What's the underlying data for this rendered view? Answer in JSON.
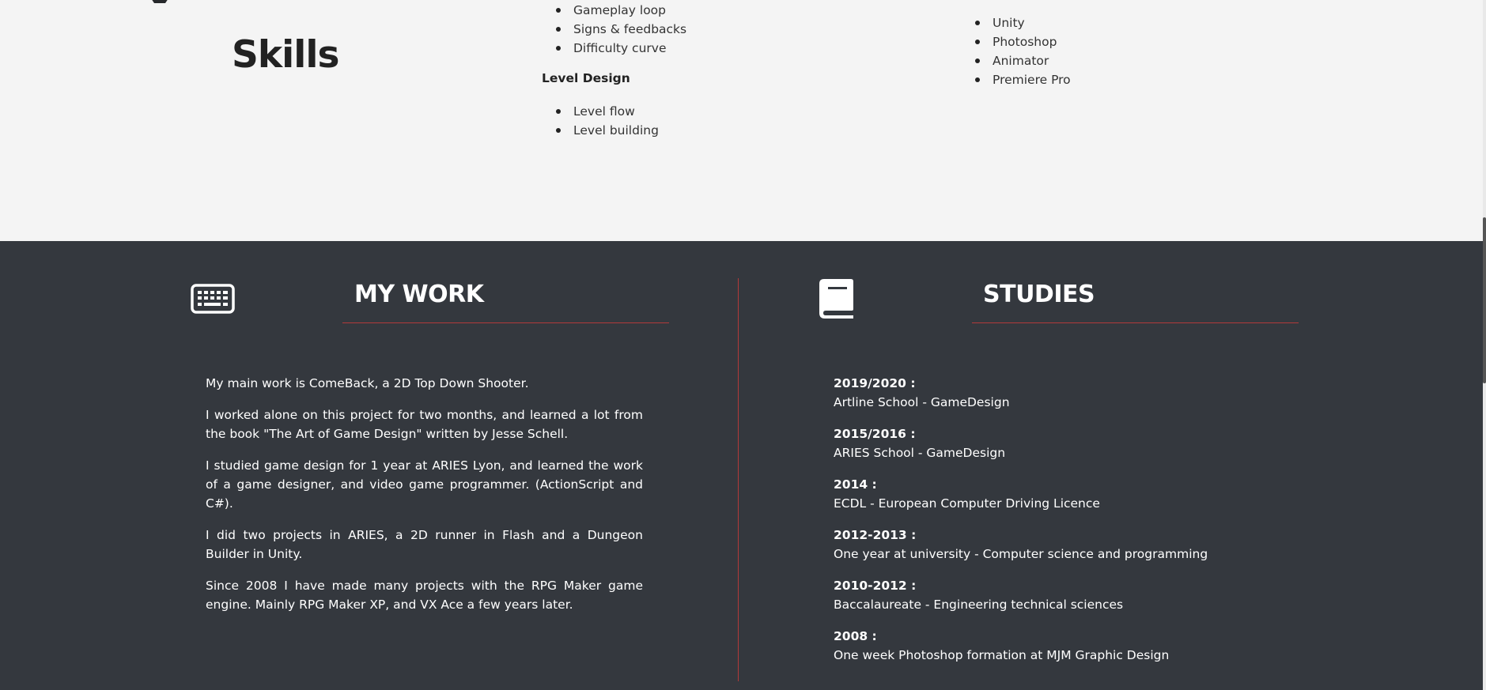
{
  "skills": {
    "title": "Skills",
    "list_a": [
      "Gameplay loop",
      "Signs & feedbacks",
      "Difficulty curve"
    ],
    "group_heading": "Level Design",
    "list_b": [
      "Level flow",
      "Level building"
    ],
    "software": [
      "Unity",
      "Photoshop",
      "Animator",
      "Premiere Pro"
    ]
  },
  "work": {
    "title": "MY WORK",
    "icon": "keyboard-icon",
    "paragraphs": [
      "My main work is ComeBack, a 2D Top Down Shooter.",
      "I worked alone on this project for two months, and learned a lot from the book \"The Art of Game Design\" written by Jesse Schell.",
      "I studied game design for 1 year at ARIES Lyon, and learned the work of a game designer, and video game programmer. (ActionScript and C#).",
      "I did two projects in ARIES, a 2D runner in Flash and a Dungeon Builder in Unity.",
      "Since 2008 I have made many projects with the RPG Maker game engine. Mainly RPG Maker XP, and VX Ace a few years later."
    ]
  },
  "studies": {
    "title": "STUDIES",
    "icon": "book-icon",
    "items": [
      {
        "year": "2019/2020 :",
        "desc": "Artline School - GameDesign"
      },
      {
        "year": "2015/2016 :",
        "desc": "ARIES School - GameDesign"
      },
      {
        "year": "2014 :",
        "desc": "ECDL - European Computer Driving Licence"
      },
      {
        "year": "2012-2013 :",
        "desc": "One year at university - Computer science and programming"
      },
      {
        "year": "2010-2012 :",
        "desc": "Baccalaureate - Engineering technical sciences"
      },
      {
        "year": "2008 :",
        "desc": "One week Photoshop formation at MJM Graphic Design"
      }
    ]
  },
  "colors": {
    "dark_bg": "#34383e",
    "light_bg": "#f4f4f4",
    "accent_rule": "#b23a3a"
  }
}
